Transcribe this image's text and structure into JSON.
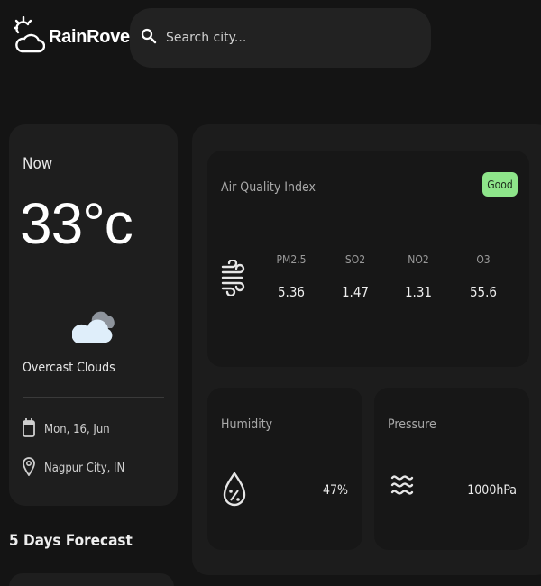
{
  "app": {
    "name": "RainRover",
    "logo_icon": "sun-cloud-icon"
  },
  "search": {
    "placeholder": "Search city...",
    "value": "",
    "icon": "search-icon"
  },
  "current": {
    "label": "Now",
    "temperature": "33°c",
    "condition": "Overcast Clouds",
    "condition_icon": "overcast-cloud-icon",
    "date": "Mon, 16, Jun",
    "date_icon": "calendar-icon",
    "location": "Nagpur City, IN",
    "location_icon": "map-pin-icon"
  },
  "forecast": {
    "title": "5 Days Forecast"
  },
  "air_quality": {
    "title": "Air Quality Index",
    "status": "Good",
    "status_color": "#8ee58a",
    "icon": "wind-icon",
    "pollutants": [
      {
        "label": "PM2.5",
        "value": "5.36"
      },
      {
        "label": "SO2",
        "value": "1.47"
      },
      {
        "label": "NO2",
        "value": "1.31"
      },
      {
        "label": "O3",
        "value": "55.6"
      }
    ]
  },
  "humidity": {
    "title": "Humidity",
    "value": "47%",
    "icon": "humidity-drop-icon"
  },
  "pressure": {
    "title": "Pressure",
    "value": "1000hPa",
    "icon": "waves-icon"
  },
  "colors": {
    "background": "#141414",
    "card": "#1e1e1e",
    "inner_card": "#171717",
    "accent_good": "#8ee58a"
  }
}
